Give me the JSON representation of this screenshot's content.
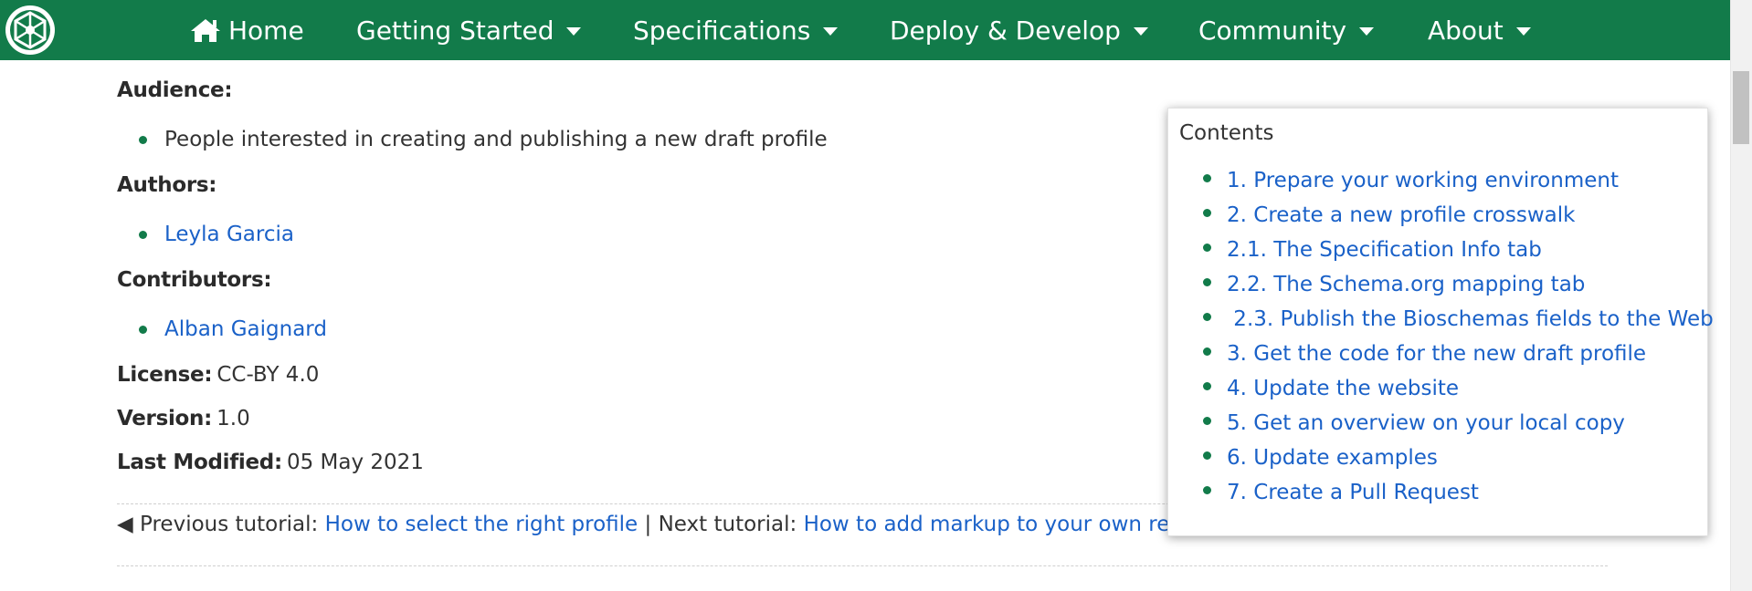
{
  "nav": {
    "home": "Home",
    "items": [
      "Getting Started",
      "Specifications",
      "Deploy & Develop",
      "Community",
      "About"
    ]
  },
  "meta": {
    "audience_label": "Audience:",
    "audience_items": [
      "People interested in creating and publishing a new draft profile"
    ],
    "authors_label": "Authors:",
    "authors": [
      "Leyla Garcia"
    ],
    "contributors_label": "Contributors:",
    "contributors": [
      "Alban Gaignard"
    ],
    "license_label": "License:",
    "license_value": "CC-BY 4.0",
    "version_label": "Version:",
    "version_value": "1.0",
    "modified_label": "Last Modified:",
    "modified_value": "05 May 2021"
  },
  "tutorial_nav": {
    "prev_arrow": "◀",
    "prev_label": "Previous tutorial:",
    "prev_link": "How to select the right profile",
    "separator": "|",
    "next_label": "Next tutorial:",
    "next_link": "How to add markup to your own reso"
  },
  "toc": {
    "title": "Contents",
    "items": [
      "1. Prepare your working environment",
      "2. Create a new profile crosswalk",
      "2.1. The Specification Info tab",
      "2.2. The Schema.org mapping tab",
      " 2.3. Publish the Bioschemas fields to the Web",
      "3. Get the code for the new draft profile",
      "4. Update the website",
      "5. Get an overview on your local copy",
      "6. Update examples",
      "7. Create a Pull Request"
    ]
  },
  "colors": {
    "brand_green": "#127b4a",
    "link_blue": "#1a61c8"
  }
}
